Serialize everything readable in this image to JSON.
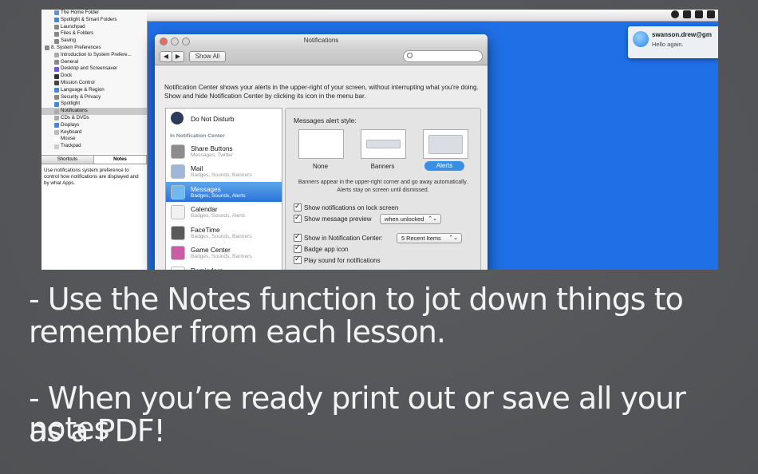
{
  "sidebar": {
    "tree": [
      {
        "label": "The Home Folder",
        "color": "#6a8fd1"
      },
      {
        "label": "Spotlight & Smart Folders",
        "color": "#4a86d8"
      },
      {
        "label": "Launchpad",
        "color": "#888"
      },
      {
        "label": "Files & Folders",
        "color": "#888"
      },
      {
        "label": "Saving",
        "color": "#888"
      },
      {
        "label": "8. System Preferences",
        "color": "#888"
      },
      {
        "label": "Introduction to System Prefere...",
        "color": "#aaa"
      },
      {
        "label": "General",
        "color": "#888"
      },
      {
        "label": "Desktop and Screensaver",
        "color": "#6b5bd4"
      },
      {
        "label": "Dock",
        "color": "#333"
      },
      {
        "label": "Mission Control",
        "color": "#444"
      },
      {
        "label": "Language & Region",
        "color": "#4a86d8"
      },
      {
        "label": "Security & Privacy",
        "color": "#888"
      },
      {
        "label": "Spotlight",
        "color": "#4a86d8"
      },
      {
        "label": "Notifications",
        "color": "#aaa"
      },
      {
        "label": "CDs & DVDs",
        "color": "#aaa"
      },
      {
        "label": "Displays",
        "color": "#4a86d8"
      },
      {
        "label": "Keyboard",
        "color": "#bbb"
      },
      {
        "label": "Mouse",
        "color": "#fff"
      },
      {
        "label": "Trackpad",
        "color": "#ccc"
      }
    ],
    "tabs": [
      "Shortcuts",
      "Notes"
    ],
    "description": "Use notifications system preference to control how notifications are displayed and by what Apps."
  },
  "window": {
    "title": "Notifications",
    "show_all": "Show All",
    "back_glyph": "◀",
    "fwd_glyph": "▶",
    "intro": "Notification Center shows your alerts in the upper-right of your screen, without interrupting what you're doing. Show and hide Notification Center by clicking its icon in the menu bar.",
    "dnd": "Do Not Disturb",
    "section": "In Notification Center",
    "apps": [
      {
        "name": "Share Buttons",
        "sub": "Messages, Twitter",
        "color": "#8c8c8c"
      },
      {
        "name": "Mail",
        "sub": "Badges, Sounds, Banners",
        "color": "#9fb7d9"
      },
      {
        "name": "Messages",
        "sub": "Badges, Sounds, Alerts",
        "color": "#6fb9f0"
      },
      {
        "name": "Calendar",
        "sub": "Badges, Sounds, Alerts",
        "color": "#f2f2f2"
      },
      {
        "name": "FaceTime",
        "sub": "Badges, Sounds, Banners",
        "color": "#5a5a5a"
      },
      {
        "name": "Game Center",
        "sub": "Badges, Sounds, Banners",
        "color": "#c95ca3"
      },
      {
        "name": "Reminders",
        "sub": "",
        "color": "#ffffff"
      }
    ],
    "alert_style_heading": "Messages alert style:",
    "styles": [
      "None",
      "Banners",
      "Alerts"
    ],
    "style_note": "Banners appear in the upper-right corner and go away automatically. Alerts stay on screen until dismissed.",
    "opt_lock": "Show notifications on lock screen",
    "opt_preview": "Show message preview",
    "preview_value": "when unlocked",
    "opt_center": "Show in Notification Center:",
    "center_value": "5 Recent Items",
    "opt_badge": "Badge app icon",
    "opt_sound": "Play sound for notifications",
    "popup_arrow": "⌃⌄"
  },
  "notification": {
    "sender": "swanson.drew@gm",
    "message": "Hello again."
  },
  "caption": {
    "line1": "- Use the Notes function to jot down things to",
    "line2": "remember from each lesson.",
    "line3": "- When you’re ready print out or save all your notes",
    "line4": "as a PDF!"
  },
  "colors": {
    "desktop": "#1f6fe6",
    "background": "#545659",
    "selection": "#2a73d8"
  }
}
